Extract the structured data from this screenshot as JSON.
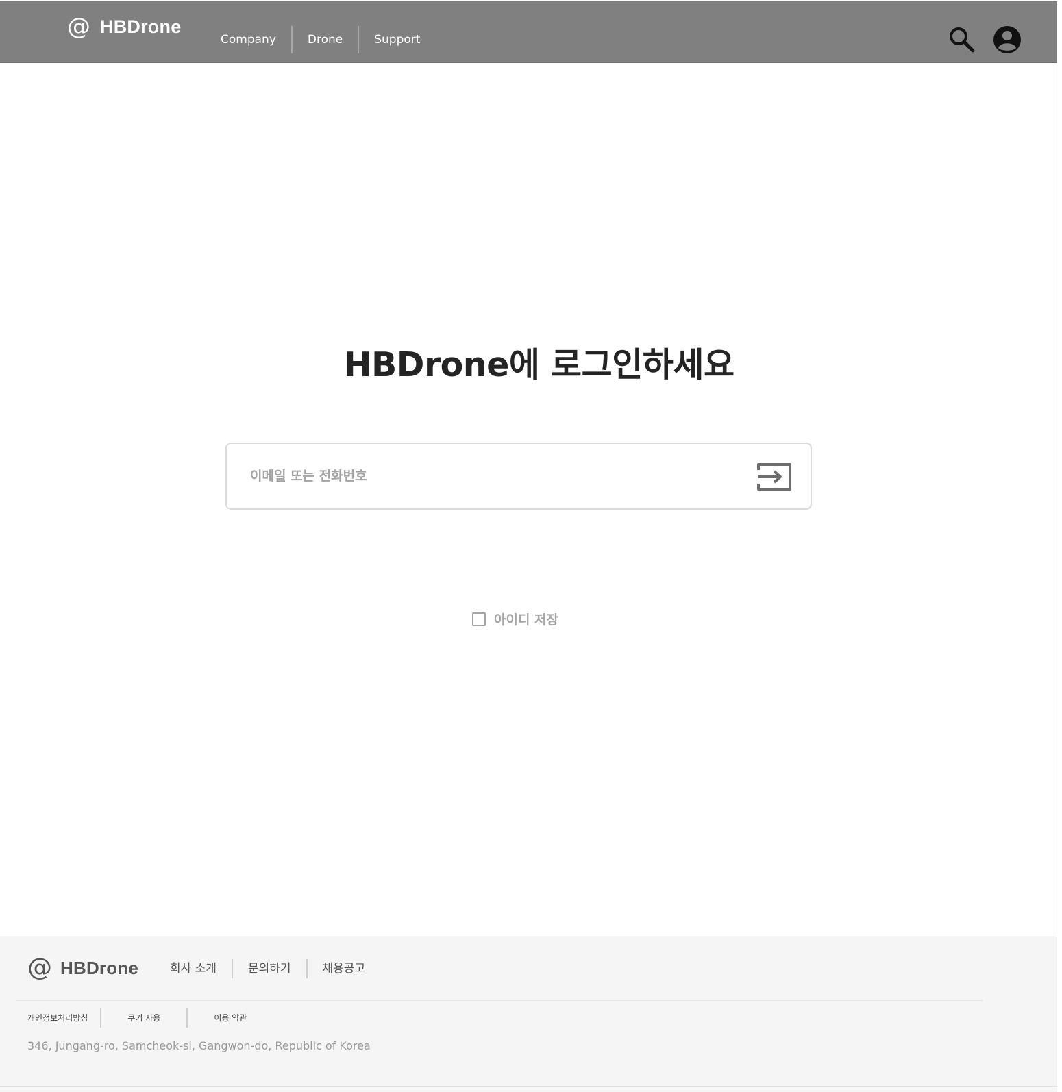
{
  "header": {
    "logo_symbol": "@",
    "logo_text": "HBDrone",
    "nav": [
      {
        "label": "Company"
      },
      {
        "label": "Drone"
      },
      {
        "label": "Support"
      }
    ],
    "icons": {
      "search": "search-icon",
      "account": "user-account-icon"
    },
    "background_color": "#808080"
  },
  "main": {
    "title": "HBDrone에 로그인하세요",
    "login_input": {
      "placeholder": "이메일 또는 전화번호",
      "value": ""
    },
    "submit_icon": "sign-in-arrow-icon",
    "remember_id": {
      "label": "아이디 저장",
      "checked": false
    }
  },
  "footer": {
    "logo_symbol": "@",
    "logo_text": "HBDrone",
    "links": [
      {
        "label": "회사 소개"
      },
      {
        "label": "문의하기"
      },
      {
        "label": "채용공고"
      }
    ],
    "legal_links": [
      {
        "label": "개인정보처리방침"
      },
      {
        "label": "쿠키 사용"
      },
      {
        "label": "이용 약관"
      }
    ],
    "address": "346, Jungang-ro, Samcheok-si, Gangwon-do, Republic of Korea",
    "background_color": "#f5f5f5"
  }
}
